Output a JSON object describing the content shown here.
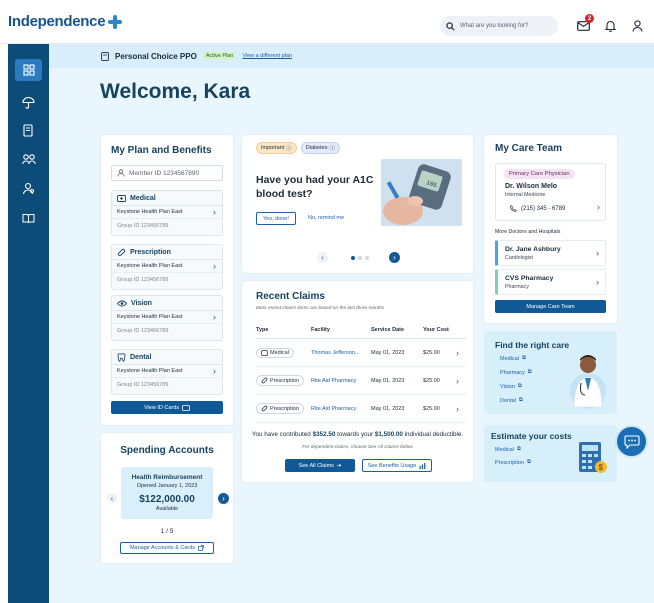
{
  "header": {
    "logo_text": "Independence",
    "search_placeholder": "What are you looking for?",
    "messages_count": "2"
  },
  "sidebar": {
    "items": [
      {
        "icon": "dashboard-icon",
        "active": true
      },
      {
        "icon": "umbrella-icon",
        "active": false
      },
      {
        "icon": "claims-document-icon",
        "active": false
      },
      {
        "icon": "care-team-icon",
        "active": false
      },
      {
        "icon": "find-care-icon",
        "active": false
      },
      {
        "icon": "book-icon",
        "active": false
      }
    ]
  },
  "planbar": {
    "plan_name": "Personal Choice PPO",
    "status": "Active Plan",
    "switch_link": "View a different plan"
  },
  "welcome": "Welcome, Kara",
  "plan_benefits": {
    "title": "My Plan and Benefits",
    "member_id": "Member ID 1234567890",
    "sections": [
      {
        "name": "Medical",
        "icon": "id-card-icon",
        "plan": "Keystone Health Plan East",
        "group": "Group ID 123456789"
      },
      {
        "name": "Prescription",
        "icon": "pill-icon",
        "plan": "Keystone Health Plan East",
        "group": "Group ID 123456789"
      },
      {
        "name": "Vision",
        "icon": "eye-icon",
        "plan": "Keystone Health Plan East",
        "group": "Group ID 123456789"
      },
      {
        "name": "Dental",
        "icon": "tooth-icon",
        "plan": "Keystone Health Plan East",
        "group": "Group ID 123456789"
      }
    ],
    "view_cards_button": "View ID Cards"
  },
  "spending": {
    "title": "Spending Accounts",
    "account_name": "Health Reimbursement",
    "opened": "Opened January 1, 2023",
    "amount": "$122,000.00",
    "amount_label": "Available",
    "pager": "1 / 5",
    "manage_button": "Manage Accounts & Cards"
  },
  "reminder": {
    "tags": [
      "Important",
      "Diabetes"
    ],
    "question_line1": "Have you had your A1C",
    "question_line2": "blood test?",
    "yes_button": "Yes, done!",
    "remind_button": "No, remind me",
    "glucometer_reading": "105"
  },
  "claims": {
    "title": "Recent Claims",
    "subtitle": "Most recent claims items are based on the last three months",
    "columns": [
      "Type",
      "Facility",
      "Service Date",
      "Your Cost"
    ],
    "rows": [
      {
        "type": "Medical",
        "type_icon": "id-card-icon",
        "facility": "Thomas Jefferson...",
        "date": "May 01, 2023",
        "cost": "$25.00"
      },
      {
        "type": "Prescription",
        "type_icon": "pill-icon",
        "facility": "Rite Aid Pharmacy",
        "date": "May 01, 2023",
        "cost": "$25.00"
      },
      {
        "type": "Prescription",
        "type_icon": "pill-icon",
        "facility": "Rite Aid Pharmacy",
        "date": "May 01, 2023",
        "cost": "$25.00"
      }
    ],
    "deductible_pre": "You have contributed",
    "deductible_amount": "$352.50",
    "deductible_mid": "towards your",
    "deductible_total": "$1,500.00",
    "deductible_post": "individual deductible.",
    "dependent_note": "For dependent claims, choose See All Claims below",
    "see_all_button": "See All Claims",
    "benefits_usage_button": "See Benefits Usage"
  },
  "care_team": {
    "title": "My Care Team",
    "pcp_badge": "Primary Care Physician",
    "pcp_name": "Dr. Wilson Melo",
    "pcp_specialty": "Internal Medicine",
    "pcp_phone": "(215) 345 - 6789",
    "more_label": "More Doctors and Hospitals",
    "others": [
      {
        "name": "Dr. Jane Ashbury",
        "role": "Cardiologist",
        "color": "#3fa9e6"
      },
      {
        "name": "CVS Pharmacy",
        "role": "Pharmacy",
        "color": "#7ad3b2"
      }
    ],
    "manage_button": "Manage Care Team"
  },
  "find_care": {
    "title": "Find the right care",
    "links": [
      "Medical",
      "Pharmacy",
      "Vision",
      "Dental"
    ]
  },
  "estimate": {
    "title": "Estimate your costs",
    "links": [
      "Medical",
      "Prescription"
    ]
  }
}
